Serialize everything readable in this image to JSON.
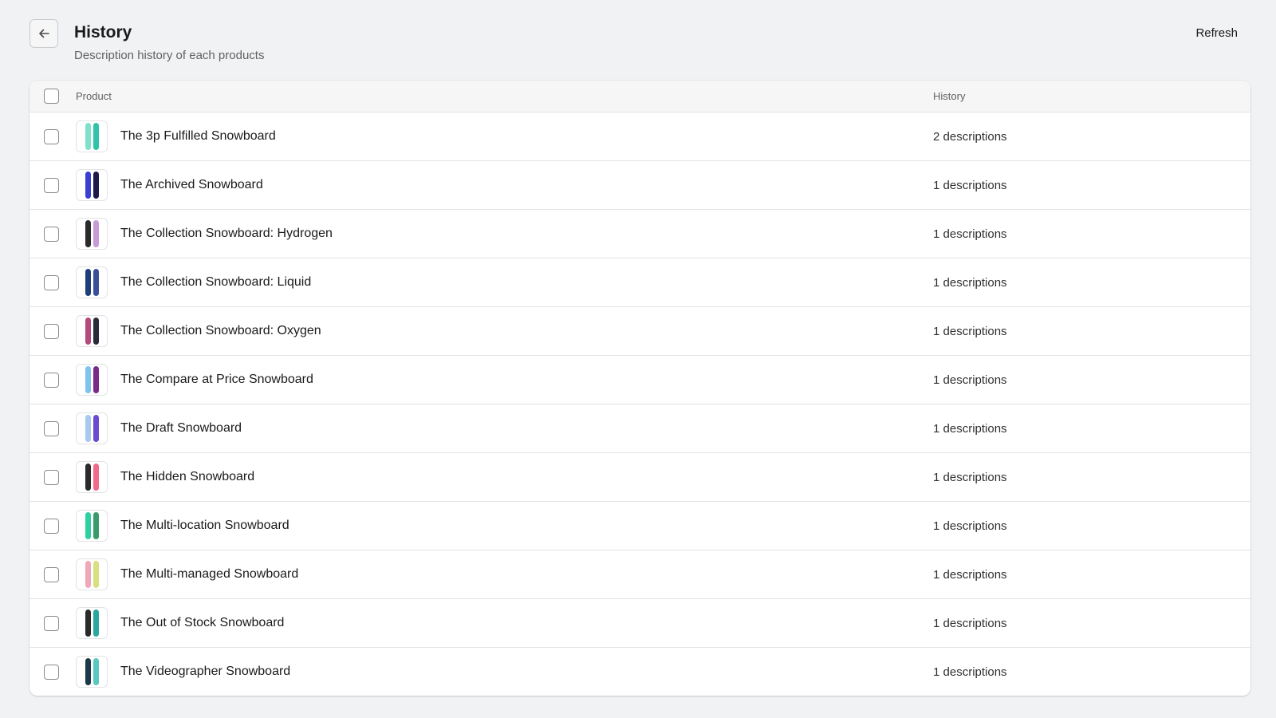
{
  "header": {
    "title": "History",
    "subtitle": "Description history of each products",
    "refresh_label": "Refresh",
    "back_icon": "arrow-left-icon"
  },
  "table": {
    "columns": [
      "Product",
      "History"
    ],
    "rows": [
      {
        "product": "The 3p Fulfilled Snowboard",
        "history": "2 descriptions",
        "colors": [
          "#7fe0cc",
          "#2fc4a8"
        ]
      },
      {
        "product": "The Archived Snowboard",
        "history": "1 descriptions",
        "colors": [
          "#3a3fd1",
          "#1c1a4a"
        ]
      },
      {
        "product": "The Collection Snowboard: Hydrogen",
        "history": "1 descriptions",
        "colors": [
          "#2a2a2a",
          "#c79ad8"
        ]
      },
      {
        "product": "The Collection Snowboard: Liquid",
        "history": "1 descriptions",
        "colors": [
          "#1d3f7a",
          "#3b4e9a"
        ]
      },
      {
        "product": "The Collection Snowboard: Oxygen",
        "history": "1 descriptions",
        "colors": [
          "#b54a7a",
          "#2a2a3a"
        ]
      },
      {
        "product": "The Compare at Price Snowboard",
        "history": "1 descriptions",
        "colors": [
          "#7fc4ec",
          "#7a2a8a"
        ]
      },
      {
        "product": "The Draft Snowboard",
        "history": "1 descriptions",
        "colors": [
          "#a8c8f0",
          "#6a4ad0"
        ]
      },
      {
        "product": "The Hidden Snowboard",
        "history": "1 descriptions",
        "colors": [
          "#2a2a2a",
          "#f06a8a"
        ]
      },
      {
        "product": "The Multi-location Snowboard",
        "history": "1 descriptions",
        "colors": [
          "#2fd0a0",
          "#3a9a6a"
        ]
      },
      {
        "product": "The Multi-managed Snowboard",
        "history": "1 descriptions",
        "colors": [
          "#f0a8b8",
          "#d8e080"
        ]
      },
      {
        "product": "The Out of Stock Snowboard",
        "history": "1 descriptions",
        "colors": [
          "#2a2a2a",
          "#2aa8a0"
        ]
      },
      {
        "product": "The Videographer Snowboard",
        "history": "1 descriptions",
        "colors": [
          "#1a3a4a",
          "#5ac8c0"
        ]
      }
    ]
  }
}
